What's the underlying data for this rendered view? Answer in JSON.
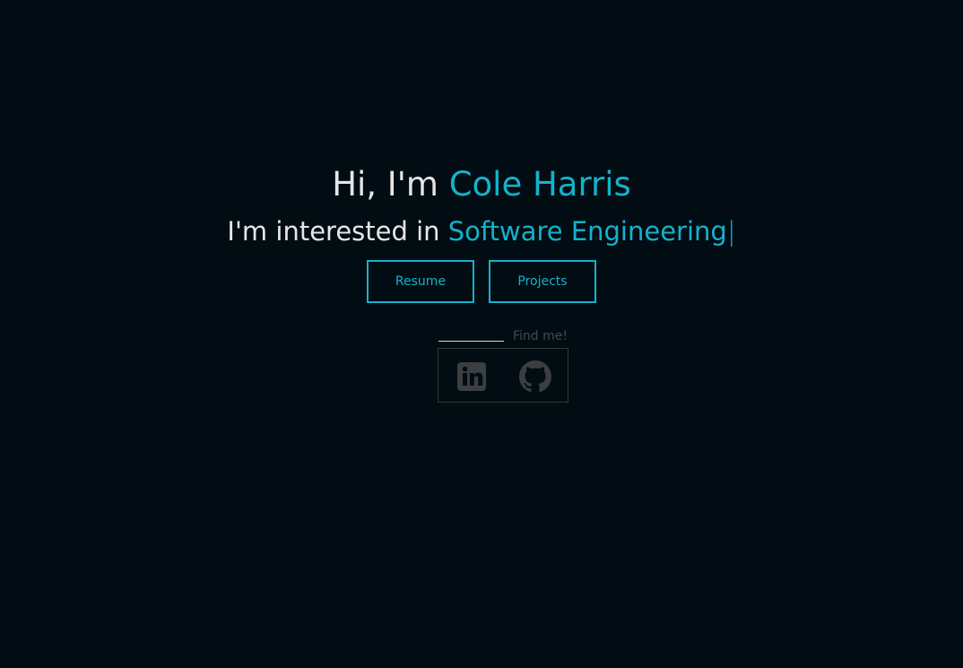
{
  "hero": {
    "greeting_prefix": "Hi, I'm ",
    "name": "Cole Harris",
    "interest_prefix": "I'm interested in ",
    "interest": "Software Engineering",
    "cursor": "|"
  },
  "buttons": {
    "resume_label": "Resume",
    "projects_label": "Projects"
  },
  "social": {
    "find_label": "Find me!",
    "links": [
      {
        "icon": "linkedin-icon"
      },
      {
        "icon": "github-icon"
      }
    ]
  },
  "colors": {
    "background": "#020c13",
    "accent": "#12b3cc",
    "text": "#e6e6e6",
    "muted": "#3f4a50"
  }
}
